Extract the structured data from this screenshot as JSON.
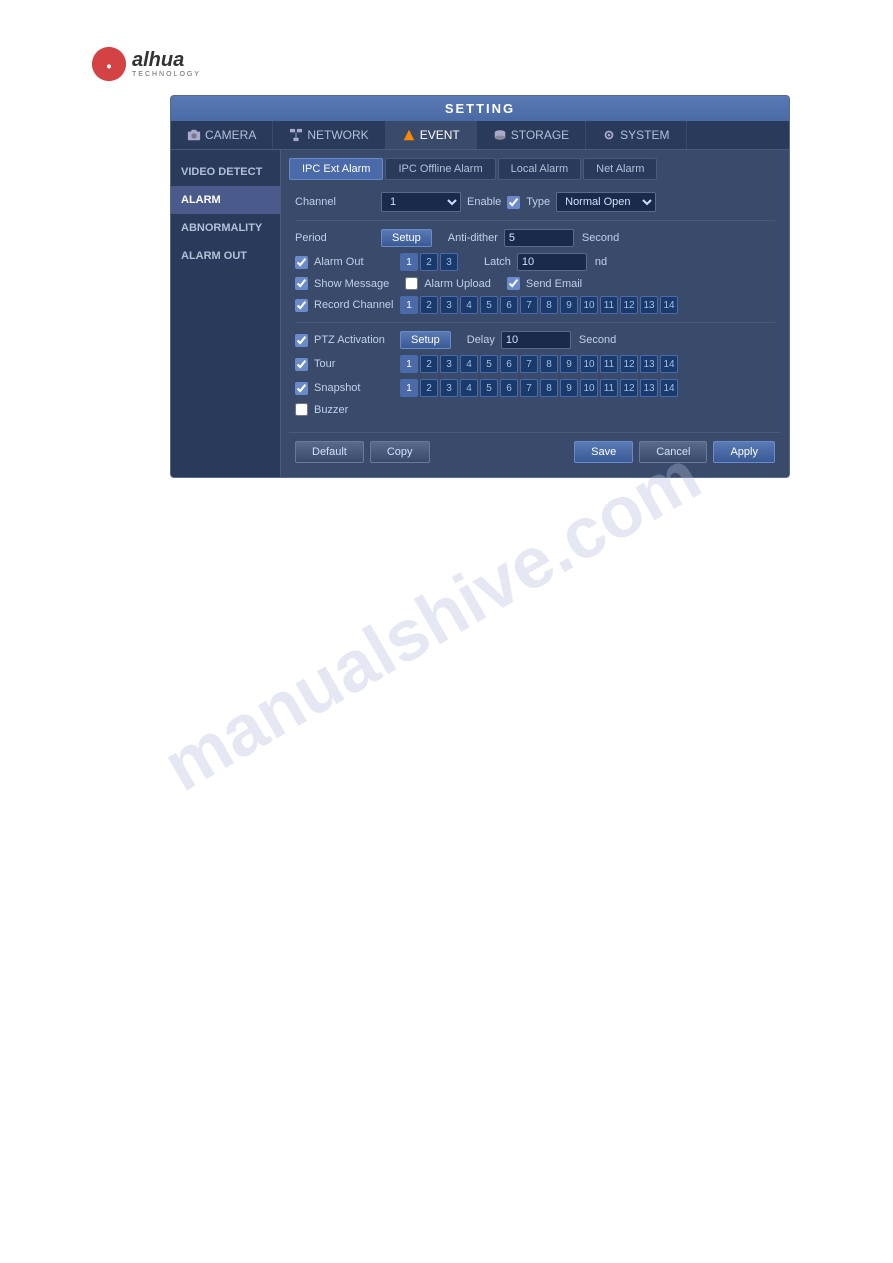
{
  "logo": {
    "text": "alhua",
    "subtitle": "TECHNOLOGY"
  },
  "window": {
    "title": "SETTING"
  },
  "nav": {
    "tabs": [
      {
        "id": "camera",
        "label": "CAMERA",
        "icon": "camera-icon"
      },
      {
        "id": "network",
        "label": "NETWORK",
        "icon": "network-icon"
      },
      {
        "id": "event",
        "label": "EVENT",
        "icon": "event-icon",
        "active": true
      },
      {
        "id": "storage",
        "label": "STORAGE",
        "icon": "storage-icon"
      },
      {
        "id": "system",
        "label": "SYSTEM",
        "icon": "system-icon"
      }
    ]
  },
  "sidebar": {
    "items": [
      {
        "id": "video-detect",
        "label": "VIDEO DETECT"
      },
      {
        "id": "alarm",
        "label": "ALARM",
        "active": true
      },
      {
        "id": "abnormality",
        "label": "ABNORMALITY"
      },
      {
        "id": "alarm-out",
        "label": "ALARM OUT"
      }
    ]
  },
  "sub_tabs": [
    {
      "id": "ipc-ext-alarm",
      "label": "IPC Ext Alarm",
      "active": true
    },
    {
      "id": "ipc-offline-alarm",
      "label": "IPC Offline Alarm"
    },
    {
      "id": "local-alarm",
      "label": "Local Alarm"
    },
    {
      "id": "net-alarm",
      "label": "Net Alarm"
    }
  ],
  "form": {
    "channel_label": "Channel",
    "channel_value": "1",
    "enable_label": "Enable",
    "type_label": "Type",
    "type_value": "Normal Open",
    "period_label": "Period",
    "period_btn": "Setup",
    "anti_dither_label": "Anti-dither",
    "anti_dither_value": "5",
    "second_label": "Second",
    "alarm_out_label": "Alarm Out",
    "alarm_out_nums": [
      "1",
      "2",
      "3"
    ],
    "latch_label": "Latch",
    "latch_value": "10",
    "latch_unit": "nd",
    "show_message_label": "Show Message",
    "alarm_upload_label": "Alarm Upload",
    "send_email_label": "Send Email",
    "record_channel_label": "Record Channel",
    "record_nums": [
      "1",
      "2",
      "3",
      "4",
      "5",
      "6",
      "7",
      "8",
      "9",
      "10",
      "11",
      "12",
      "13",
      "14"
    ],
    "ptz_activation_label": "PTZ Activation",
    "ptz_setup_btn": "Setup",
    "delay_label": "Delay",
    "delay_value": "10",
    "delay_unit": "Second",
    "tour_label": "Tour",
    "tour_nums": [
      "1",
      "2",
      "3",
      "4",
      "5",
      "6",
      "7",
      "8",
      "9",
      "10",
      "11",
      "12",
      "13",
      "14"
    ],
    "snapshot_label": "Snapshot",
    "snapshot_nums": [
      "1",
      "2",
      "3",
      "4",
      "5",
      "6",
      "7",
      "8",
      "9",
      "10",
      "11",
      "12",
      "13",
      "14"
    ],
    "buzzer_label": "Buzzer"
  },
  "buttons": {
    "default": "Default",
    "copy": "Copy",
    "save": "Save",
    "cancel": "Cancel",
    "apply": "Apply"
  },
  "watermark": "manualshive.com"
}
